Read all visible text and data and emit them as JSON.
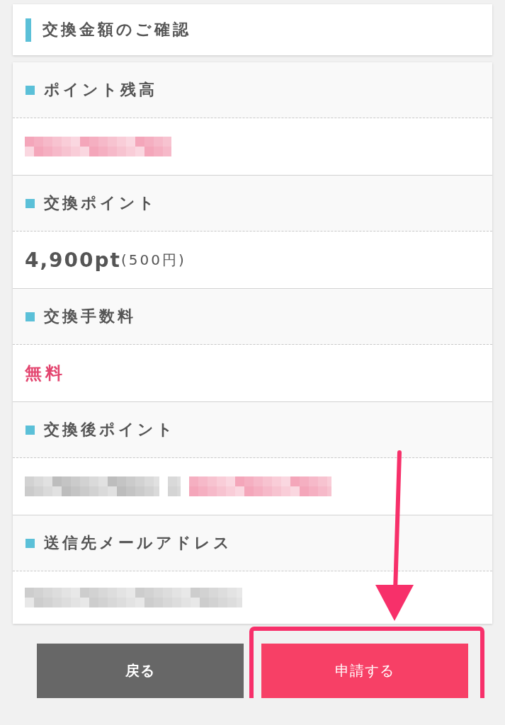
{
  "header": {
    "title": "交換金額のご確認"
  },
  "items": [
    {
      "label": "ポイント残高",
      "value": {
        "kind": "mosaic",
        "blocks": [
          {
            "color": "#f4a6ba"
          }
        ]
      }
    },
    {
      "label": "交換ポイント",
      "value": {
        "kind": "amount",
        "main": "4,900pt",
        "sub": "(500円)"
      }
    },
    {
      "label": "交換手数料",
      "value": {
        "kind": "emphasis",
        "text": "無料"
      }
    },
    {
      "label": "交換後ポイント",
      "value": {
        "kind": "mosaic",
        "blocks": [
          {
            "color": "#bdbdbd"
          },
          {
            "color": "#cfcfcf"
          },
          {
            "color": "#f4a6ba"
          }
        ]
      }
    },
    {
      "label": "送信先メールアドレス",
      "value": {
        "kind": "mosaic",
        "blocks": [
          {
            "color": "#cdcdcd"
          }
        ]
      }
    }
  ],
  "buttons": [
    {
      "label": "戻る",
      "kind": "back",
      "highlighted": false
    },
    {
      "label": "申請する",
      "kind": "primary",
      "highlighted": true
    }
  ]
}
